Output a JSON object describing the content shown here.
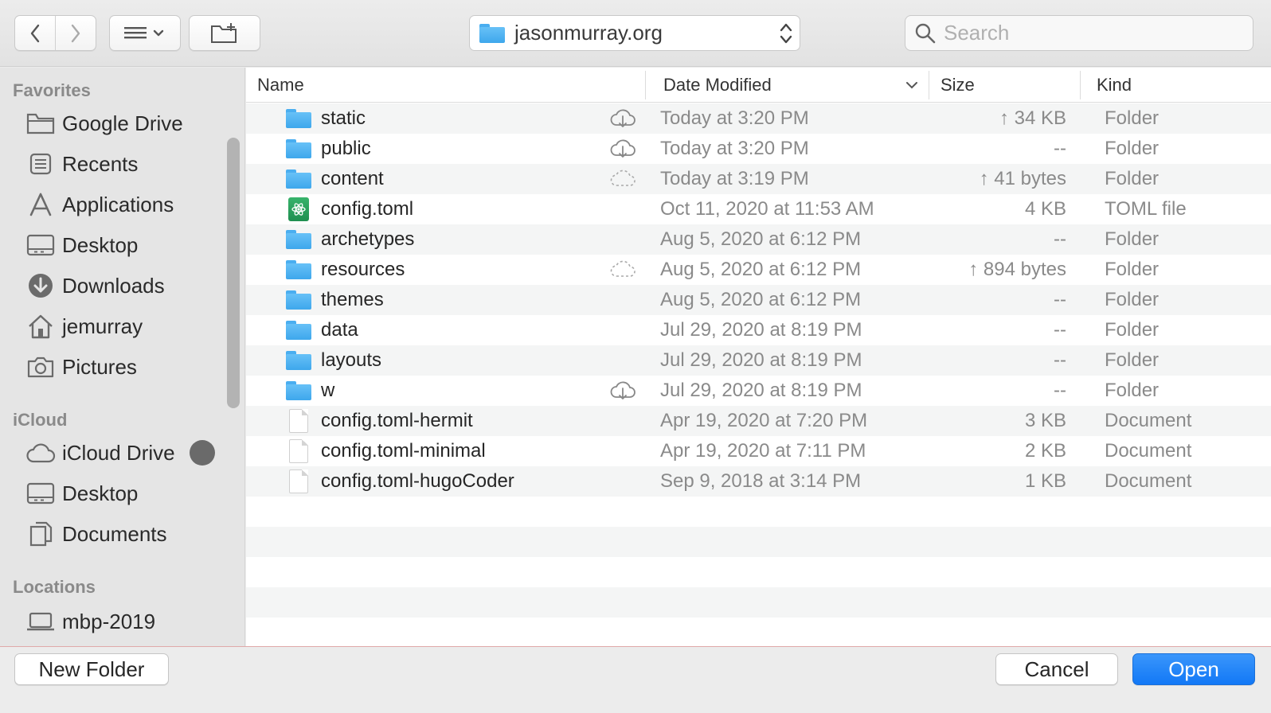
{
  "toolbar": {
    "path_label": "jasonmurray.org",
    "search_placeholder": "Search"
  },
  "sidebar": {
    "sections": [
      {
        "title": "Favorites",
        "items": [
          {
            "label": "Google Drive",
            "icon": "folder-icon"
          },
          {
            "label": "Recents",
            "icon": "recents-icon"
          },
          {
            "label": "Applications",
            "icon": "applications-icon"
          },
          {
            "label": "Desktop",
            "icon": "desktop-icon"
          },
          {
            "label": "Downloads",
            "icon": "downloads-icon"
          },
          {
            "label": "jemurray",
            "icon": "home-icon"
          },
          {
            "label": "Pictures",
            "icon": "camera-icon"
          }
        ]
      },
      {
        "title": "iCloud",
        "items": [
          {
            "label": "iCloud Drive",
            "icon": "cloud-icon"
          },
          {
            "label": "Desktop",
            "icon": "desktop-icon"
          },
          {
            "label": "Documents",
            "icon": "documents-icon"
          }
        ]
      },
      {
        "title": "Locations",
        "items": [
          {
            "label": "mbp-2019",
            "icon": "laptop-icon"
          }
        ]
      }
    ]
  },
  "columns": {
    "name": "Name",
    "date": "Date Modified",
    "size": "Size",
    "kind": "Kind"
  },
  "files": [
    {
      "name": "static",
      "type": "folder",
      "cloud": "download",
      "date": "Today at 3:20 PM",
      "size": "↑ 34 KB",
      "kind": "Folder"
    },
    {
      "name": "public",
      "type": "folder",
      "cloud": "download",
      "date": "Today at 3:20 PM",
      "size": "--",
      "kind": "Folder"
    },
    {
      "name": "content",
      "type": "folder",
      "cloud": "pending",
      "date": "Today at 3:19 PM",
      "size": "↑ 41 bytes",
      "kind": "Folder"
    },
    {
      "name": "config.toml",
      "type": "toml",
      "cloud": "",
      "date": "Oct 11, 2020 at 11:53 AM",
      "size": "4 KB",
      "kind": "TOML file"
    },
    {
      "name": "archetypes",
      "type": "folder",
      "cloud": "",
      "date": "Aug 5, 2020 at 6:12 PM",
      "size": "--",
      "kind": "Folder"
    },
    {
      "name": "resources",
      "type": "folder",
      "cloud": "pending",
      "date": "Aug 5, 2020 at 6:12 PM",
      "size": "↑ 894 bytes",
      "kind": "Folder"
    },
    {
      "name": "themes",
      "type": "folder",
      "cloud": "",
      "date": "Aug 5, 2020 at 6:12 PM",
      "size": "--",
      "kind": "Folder"
    },
    {
      "name": "data",
      "type": "folder",
      "cloud": "",
      "date": "Jul 29, 2020 at 8:19 PM",
      "size": "--",
      "kind": "Folder"
    },
    {
      "name": "layouts",
      "type": "folder",
      "cloud": "",
      "date": "Jul 29, 2020 at 8:19 PM",
      "size": "--",
      "kind": "Folder"
    },
    {
      "name": "w",
      "type": "folder",
      "cloud": "download",
      "date": "Jul 29, 2020 at 8:19 PM",
      "size": "--",
      "kind": "Folder"
    },
    {
      "name": "config.toml-hermit",
      "type": "doc",
      "cloud": "",
      "date": "Apr 19, 2020 at 7:20 PM",
      "size": "3 KB",
      "kind": "Document"
    },
    {
      "name": "config.toml-minimal",
      "type": "doc",
      "cloud": "",
      "date": "Apr 19, 2020 at 7:11 PM",
      "size": "2 KB",
      "kind": "Document"
    },
    {
      "name": "config.toml-hugoCoder",
      "type": "doc",
      "cloud": "",
      "date": "Sep 9, 2018 at 3:14 PM",
      "size": "1 KB",
      "kind": "Document"
    }
  ],
  "buttons": {
    "new_folder": "New Folder",
    "cancel": "Cancel",
    "open": "Open"
  },
  "colors": {
    "accent": "#1278f6",
    "folder": "#4aaef0"
  }
}
